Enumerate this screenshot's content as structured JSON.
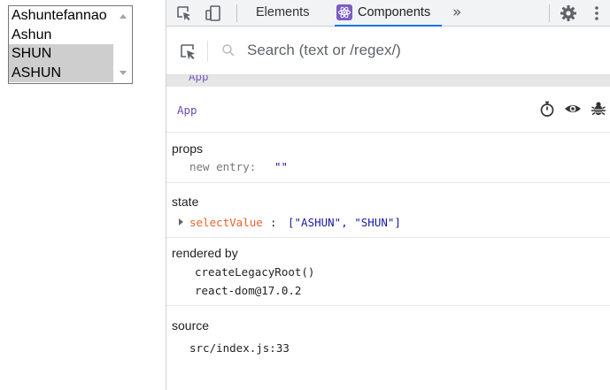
{
  "listbox": {
    "options": [
      {
        "label": "Ashuntefannao",
        "selected": false
      },
      {
        "label": "Ashun",
        "selected": false
      },
      {
        "label": "SHUN",
        "selected": true
      },
      {
        "label": "ASHUN",
        "selected": true
      }
    ]
  },
  "devtools": {
    "tabs": {
      "elements": "Elements",
      "components": "Components",
      "more": "»"
    },
    "search": {
      "placeholder": "Search (text or /regex/)"
    },
    "breadcrumb": "App",
    "component": {
      "name": "App"
    },
    "props": {
      "title": "props",
      "new_entry_key": "new entry:",
      "new_entry_value": "\"\""
    },
    "state": {
      "title": "state",
      "key": "selectValue",
      "colon": ":",
      "value": "[\"ASHUN\", \"SHUN\"]"
    },
    "rendered_by": {
      "title": "rendered by",
      "items": [
        "createLegacyRoot()",
        "react-dom@17.0.2"
      ]
    },
    "source": {
      "title": "source",
      "file": "src/index.js:33"
    }
  },
  "colors": {
    "accent": "#1a73e8",
    "component_name": "#6a4cb5",
    "state_key": "#e8622c",
    "string_value": "#1a1aa6",
    "selected_option": "#cecece"
  },
  "icons": {
    "toolbar": [
      "inspect-element-icon",
      "device-toggle-icon",
      "react-components-icon",
      "settings-gear-icon",
      "more-options-icon"
    ],
    "component_actions": [
      "stopwatch-icon",
      "eye-icon",
      "bug-icon"
    ]
  }
}
